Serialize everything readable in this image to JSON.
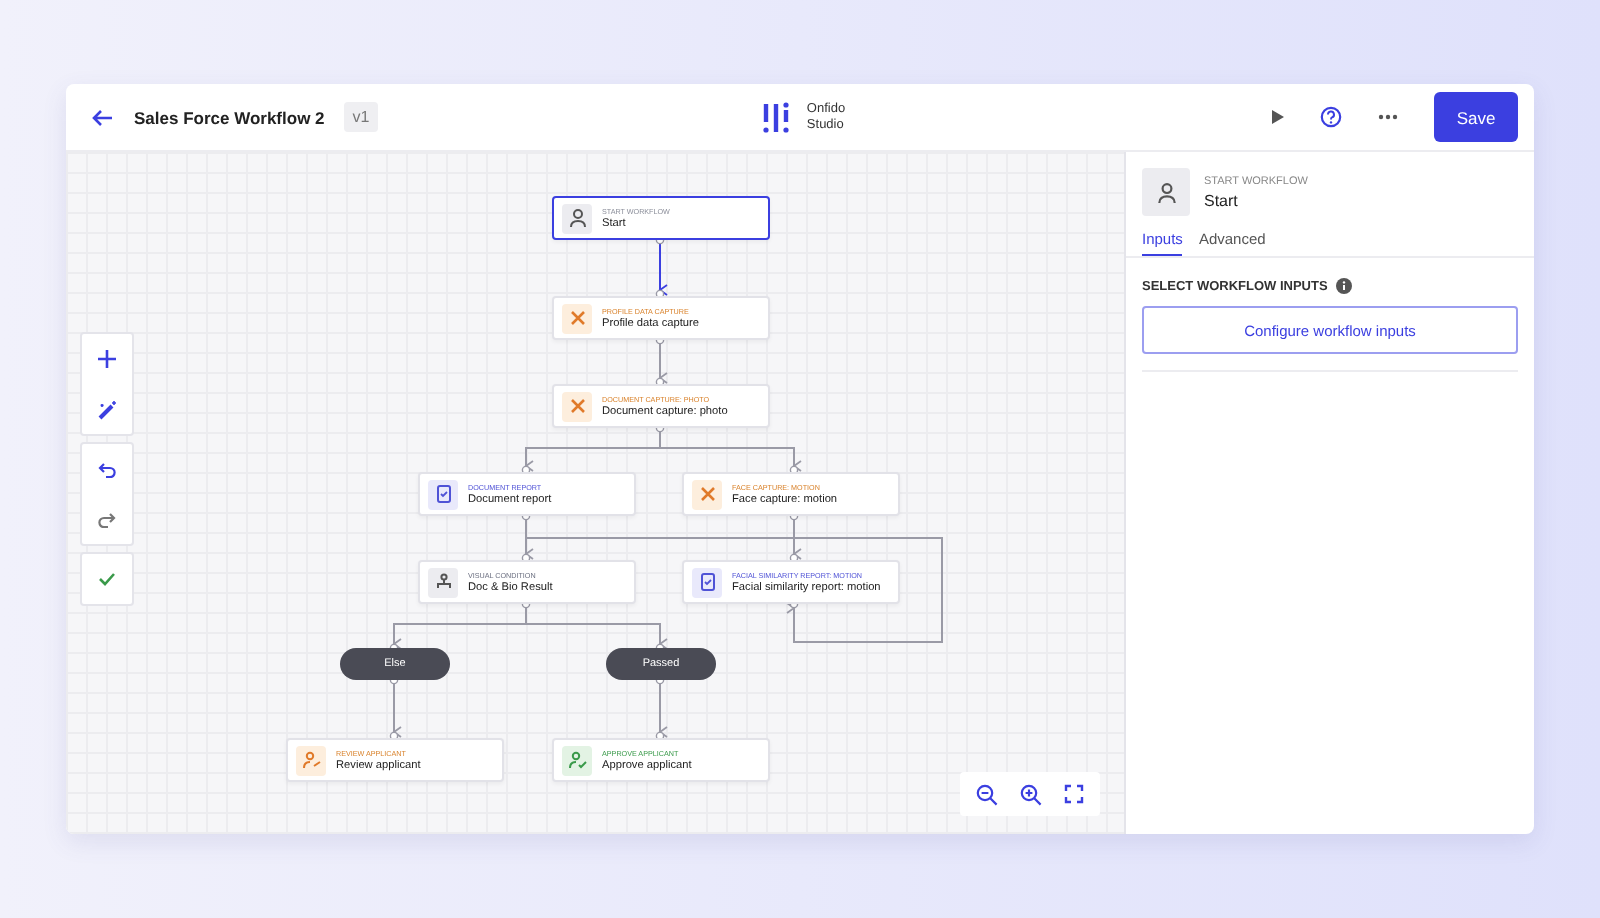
{
  "header": {
    "title": "Sales Force Workflow 2",
    "version": "v1",
    "logo_line_1": "Onfido",
    "logo_line_2": "Studio",
    "save": "Save"
  },
  "nodes": [
    {
      "kind": "start",
      "category": "START WORKFLOW",
      "label": "Start",
      "selected": true
    },
    {
      "kind": "capture",
      "category": "PROFILE DATA CAPTURE",
      "label": "Profile data capture",
      "selected": false
    },
    {
      "kind": "capture",
      "category": "DOCUMENT CAPTURE: PHOTO",
      "label": "Document capture: photo",
      "selected": false
    },
    {
      "kind": "report",
      "category": "DOCUMENT REPORT",
      "label": "Document report",
      "selected": false
    },
    {
      "kind": "capture",
      "category": "FACE CAPTURE: MOTION",
      "label": "Face capture: motion",
      "selected": false
    },
    {
      "kind": "condition",
      "category": "VISUAL CONDITION",
      "label": "Doc & Bio Result",
      "selected": false
    },
    {
      "kind": "report",
      "category": "FACIAL SIMILARITY REPORT: MOTION",
      "label": "Facial similarity report: motion",
      "selected": false
    },
    {
      "kind": "review",
      "category": "REVIEW APPLICANT",
      "label": "Review applicant",
      "selected": false
    },
    {
      "kind": "approve",
      "category": "APPROVE APPLICANT",
      "label": "Approve applicant",
      "selected": false
    }
  ],
  "branches": [
    {
      "label": "Else"
    },
    {
      "label": "Passed"
    }
  ],
  "panel": {
    "category": "START WORKFLOW",
    "title": "Start",
    "tabs": [
      {
        "label": "Inputs",
        "selected": true
      },
      {
        "label": "Advanced",
        "selected": false
      }
    ],
    "section": "SELECT WORKFLOW INPUTS",
    "button": "Configure workflow inputs"
  }
}
